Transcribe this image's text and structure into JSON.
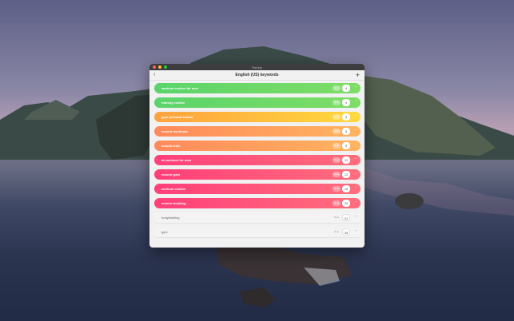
{
  "window": {
    "title": "Rankly"
  },
  "toolbar": {
    "title": "English (US) keywords",
    "back_icon": "chevron-left-icon",
    "add_icon": "plus-icon"
  },
  "keywords": [
    {
      "label": "workout routine for men",
      "badge": "New",
      "rank": "4",
      "color": "green",
      "more": "···"
    },
    {
      "label": "training routine",
      "badge": "New",
      "rank": "4",
      "color": "green",
      "more": "···"
    },
    {
      "label": "gym personal trainer",
      "badge": "New",
      "rank": "5",
      "color": "yellow",
      "more": "···"
    },
    {
      "label": "muscle workouts",
      "badge": "New",
      "rank": "6",
      "color": "orange",
      "more": "···"
    },
    {
      "label": "muscle train",
      "badge": "New",
      "rank": "9",
      "color": "orange",
      "more": "···"
    },
    {
      "label": "ab workout for men",
      "badge": "New",
      "rank": "11",
      "color": "pink",
      "more": "···"
    },
    {
      "label": "muscle gain",
      "badge": "New",
      "rank": "12",
      "color": "pink",
      "more": "···"
    },
    {
      "label": "workout routine",
      "badge": "New",
      "rank": "16",
      "color": "pink",
      "more": "···"
    },
    {
      "label": "muscle building",
      "badge": "New",
      "rank": "20",
      "color": "pink",
      "more": "···"
    },
    {
      "label": "bodybuilding",
      "badge": "New",
      "rank": "31",
      "color": "plain",
      "more": "···"
    },
    {
      "label": "gym",
      "badge": "New",
      "rank": "35",
      "color": "plain",
      "more": "···"
    }
  ]
}
